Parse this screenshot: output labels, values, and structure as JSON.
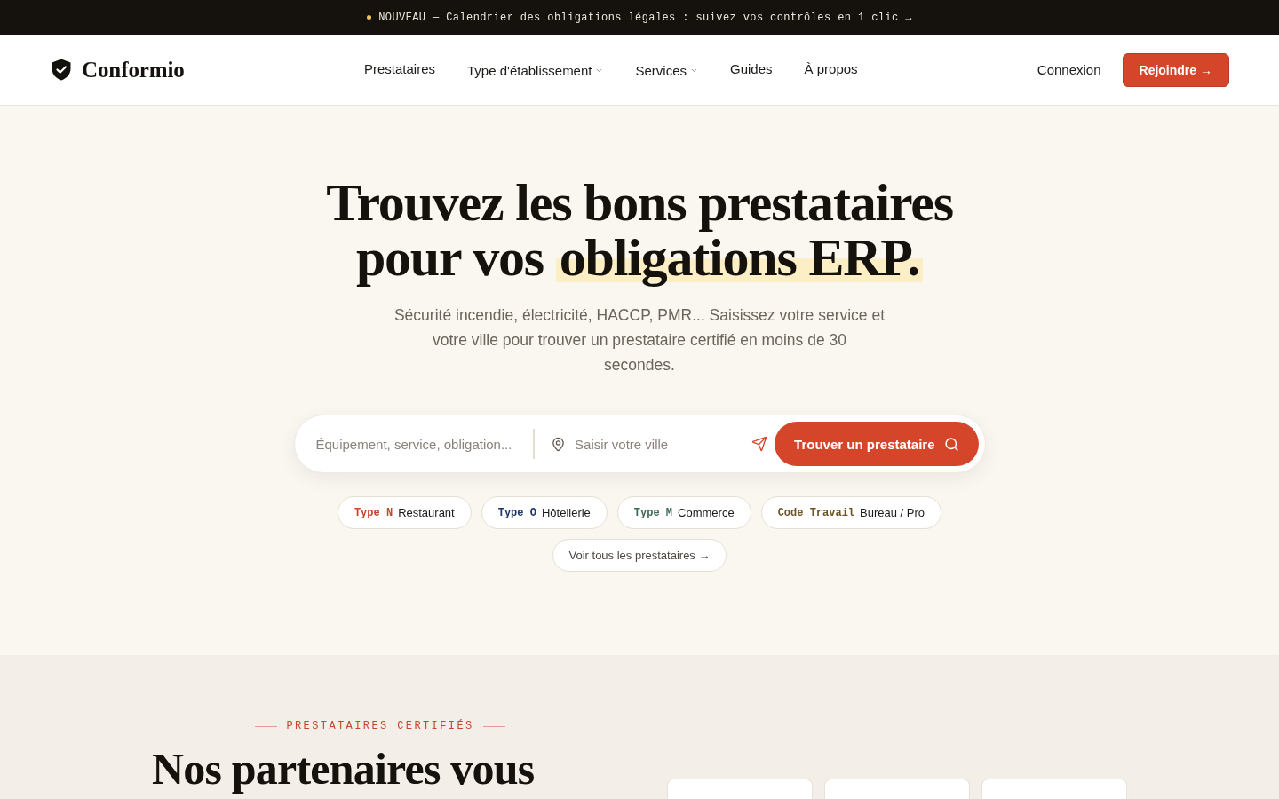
{
  "announcement": {
    "text": "NOUVEAU — Calendrier des obligations légales : suivez vos contrôles en 1 clic →"
  },
  "header": {
    "logo": "Conformio",
    "nav": [
      {
        "label": "Prestataires",
        "has_menu": false
      },
      {
        "label": "Type d'établissement",
        "has_menu": true
      },
      {
        "label": "Services",
        "has_menu": true
      },
      {
        "label": "Guides",
        "has_menu": false
      },
      {
        "label": "À propos",
        "has_menu": false
      }
    ],
    "login": "Connexion",
    "cta": "Rejoindre →"
  },
  "hero": {
    "title": "Trouvez les bons prestataires pour vos",
    "title_highlight": "obligations ERP.",
    "subtitle_lines": [
      "Sécurité incendie, électricité, HACCP, PMR... Saisissez votre service et",
      "votre ville pour trouver un prestataire certifié en moins de 30",
      "secondes."
    ],
    "search": {
      "service_placeholder": "Équipement, service, obligation...",
      "city_placeholder": "Saisir votre ville",
      "button": "Trouver un prestataire"
    },
    "chips": [
      {
        "code": "Type N",
        "label": "Restaurant",
        "color": "#c8442a"
      },
      {
        "code": "Type O",
        "label": "Hôtellerie",
        "color": "#1f3566"
      },
      {
        "code": "Type M",
        "label": "Commerce",
        "color": "#3f6a55"
      },
      {
        "code": "Code Travail",
        "label": "Bureau / Pro",
        "color": "#6b5322"
      }
    ],
    "all_link": "Voir tous les prestataires →"
  },
  "partners": {
    "eyebrow": "PRESTATAIRES CERTIFIÉS",
    "title": "Nos partenaires vous"
  }
}
